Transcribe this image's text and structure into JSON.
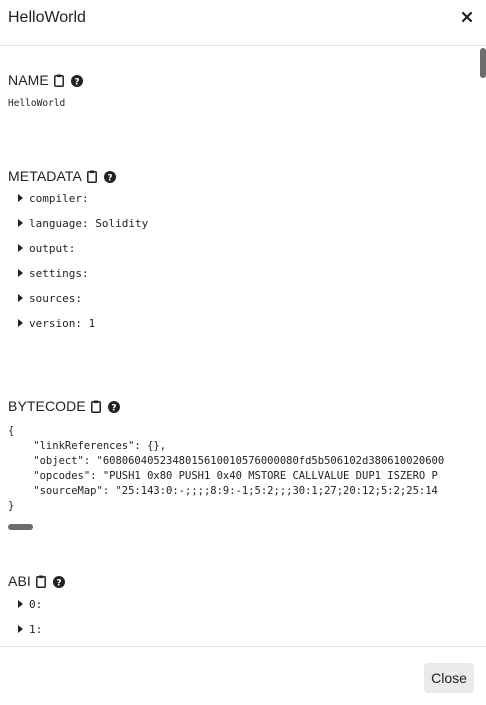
{
  "modal": {
    "title": "HelloWorld",
    "close_label": "Close"
  },
  "sections": {
    "name": {
      "title": "NAME",
      "value": "HelloWorld"
    },
    "metadata": {
      "title": "METADATA",
      "items": [
        "compiler:",
        "language: Solidity",
        "output:",
        "settings:",
        "sources:",
        "version: 1"
      ]
    },
    "bytecode": {
      "title": "BYTECODE",
      "lines": [
        "{",
        "    \"linkReferences\": {},",
        "    \"object\": \"6080604052348015610010576000080fd5b506102d380610020600",
        "    \"opcodes\": \"PUSH1 0x80 PUSH1 0x40 MSTORE CALLVALUE DUP1 ISZERO P",
        "    \"sourceMap\": \"25:143:0:-;;;;8:9:-1;5:2;;;30:1;27;20:12;5:2;25:14",
        "}"
      ]
    },
    "abi": {
      "title": "ABI",
      "items": [
        "0:",
        "1:"
      ]
    }
  },
  "icons": {
    "clipboard": "clipboard-icon",
    "help": "question-circle-icon",
    "close": "close-icon",
    "caret": "caret-right-icon"
  }
}
